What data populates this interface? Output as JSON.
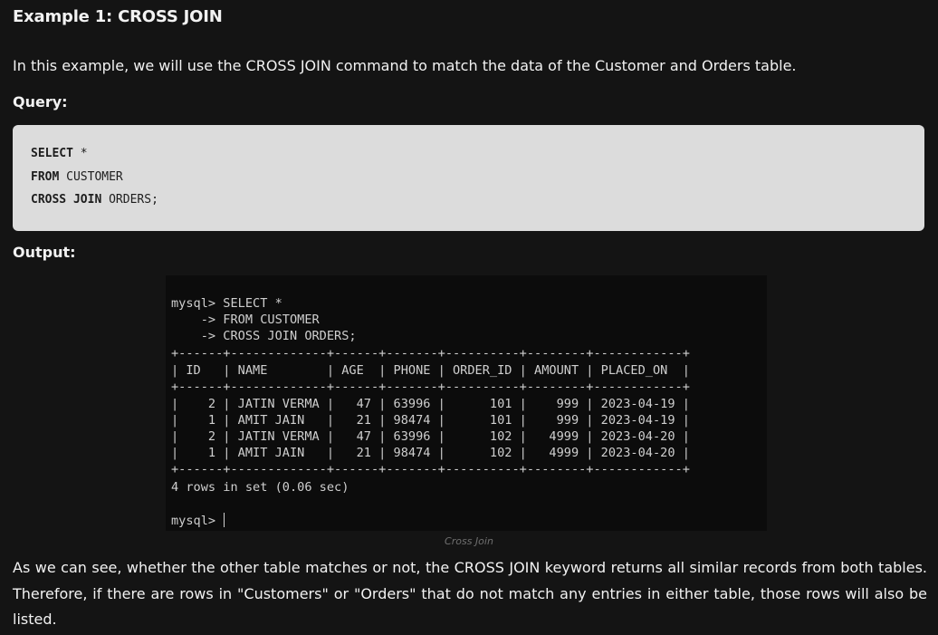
{
  "heading": "Example 1: CROSS JOIN",
  "intro": "In this example, we will use the CROSS JOIN command to match the data of the Customer and Orders table.",
  "query_label": "Query:",
  "code": {
    "line1_kw": "SELECT",
    "line1_rest": " *",
    "line2_kw": "FROM",
    "line2_rest": " CUSTOMER",
    "line3_kw": "CROSS JOIN",
    "line3_rest": " ORDERS;"
  },
  "output_label": "Output:",
  "terminal": {
    "cut_line": "+-----+-------------+-----+-------+",
    "prompt1": "mysql> SELECT *",
    "prompt2": "    -> FROM CUSTOMER",
    "prompt3": "    -> CROSS JOIN ORDERS;",
    "border": "+------+-------------+------+-------+----------+--------+------------+",
    "header": "| ID   | NAME        | AGE  | PHONE | ORDER_ID | AMOUNT | PLACED_ON  |",
    "rows": [
      "|    2 | JATIN VERMA |   47 | 63996 |      101 |    999 | 2023-04-19 |",
      "|    1 | AMIT JAIN   |   21 | 98474 |      101 |    999 | 2023-04-19 |",
      "|    2 | JATIN VERMA |   47 | 63996 |      102 |   4999 | 2023-04-20 |",
      "|    1 | AMIT JAIN   |   21 | 98474 |      102 |   4999 | 2023-04-20 |"
    ],
    "summary": "4 rows in set (0.06 sec)",
    "final_prompt": "mysql> "
  },
  "caption": "Cross Join",
  "conclusion": "As we can see, whether the other table matches or not, the CROSS JOIN keyword returns all similar records from both tables. Therefore, if there are rows in \"Customers\" or \"Orders\" that do not match any entries in either table, those rows will also be listed."
}
